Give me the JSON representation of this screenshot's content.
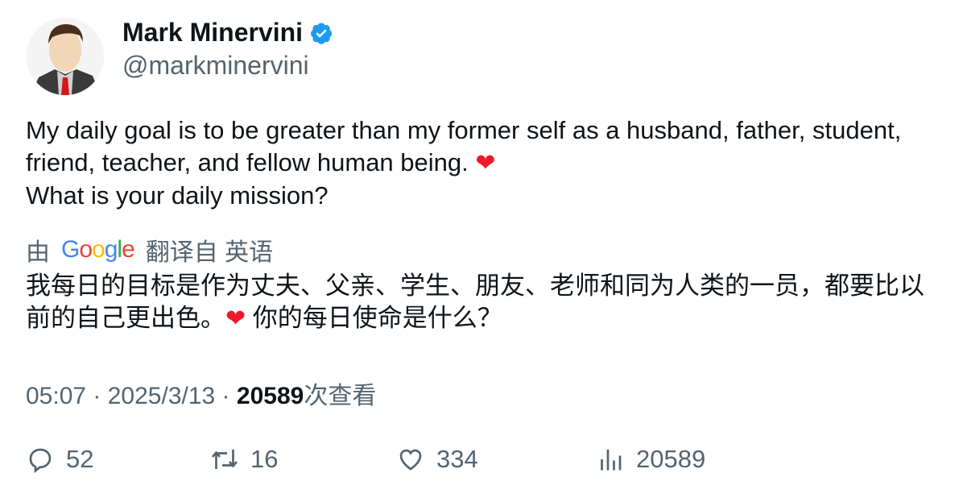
{
  "author": {
    "name": "Mark Minervini",
    "handle": "@markminervini",
    "verified_color": "#1d9bf0"
  },
  "tweet": {
    "line1": "My daily goal is to be greater than my former self as a husband, father, student, friend, teacher, and fellow human being.",
    "heart": "❤",
    "line2": "What is your daily mission?"
  },
  "translation": {
    "prefix": "由",
    "provider_letters": [
      {
        "c": "G",
        "color": "#4285f4"
      },
      {
        "c": "o",
        "color": "#ea4335"
      },
      {
        "c": "o",
        "color": "#fbbc05"
      },
      {
        "c": "g",
        "color": "#4285f4"
      },
      {
        "c": "l",
        "color": "#34a853"
      },
      {
        "c": "e",
        "color": "#ea4335"
      }
    ],
    "suffix": "翻译自 英语",
    "text_part1": "我每日的目标是作为丈夫、父亲、学生、朋友、老师和同为人类的一员，都要比以前的自己更出色。",
    "heart": "❤",
    "text_part2": " 你的每日使命是什么？"
  },
  "meta": {
    "time": "05:07",
    "sep1": " · ",
    "date": "2025/3/13",
    "sep2": " · ",
    "views": "20589",
    "views_label": "次查看"
  },
  "actions": {
    "replies": "52",
    "reposts": "16",
    "likes": "334",
    "views": "20589"
  }
}
